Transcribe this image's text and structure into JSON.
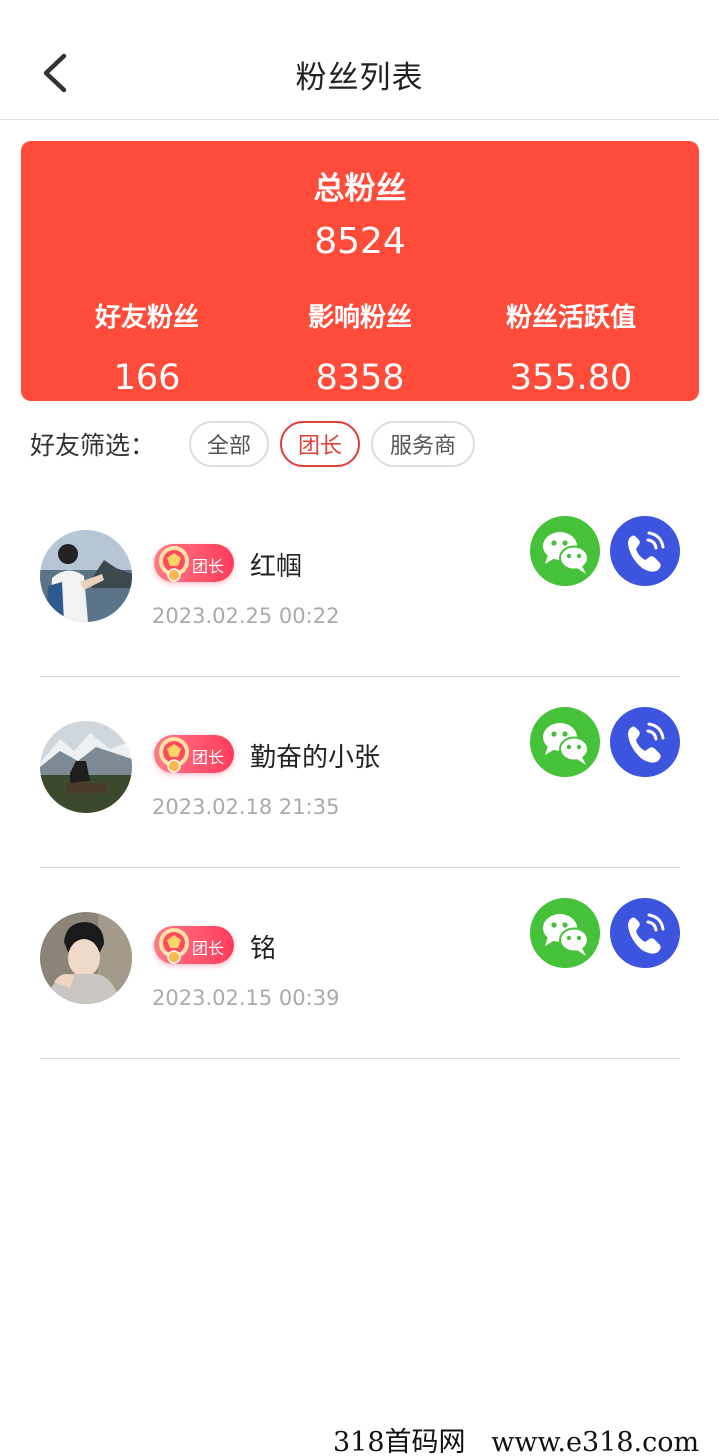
{
  "header": {
    "title": "粉丝列表"
  },
  "summary": {
    "total_label": "总粉丝",
    "total_value": "8524",
    "stats": [
      {
        "label": "好友粉丝",
        "value": "166"
      },
      {
        "label": "影响粉丝",
        "value": "8358"
      },
      {
        "label": "粉丝活跃值",
        "value": "355.80"
      }
    ],
    "accent_color": "#ff4b3a"
  },
  "filter": {
    "label": "好友筛选：",
    "options": [
      "全部",
      "团长",
      "服务商"
    ],
    "selected": "团长"
  },
  "fans": [
    {
      "name": "红帼",
      "badge": "团长",
      "time": "2023.02.25  00:22"
    },
    {
      "name": "勤奋的小张",
      "badge": "团长",
      "time": "2023.02.18  21:35"
    },
    {
      "name": "铭",
      "badge": "团长",
      "time": "2023.02.15  00:39"
    }
  ],
  "icons": {
    "back": "chevron-left-icon",
    "wechat": "wechat-icon",
    "phone": "phone-icon",
    "badge": "medal-icon"
  },
  "colors": {
    "wechat": "#45c13a",
    "phone": "#3d55de",
    "chip_active": "#e0403a"
  },
  "watermark": "318首码网   www.e318.com"
}
